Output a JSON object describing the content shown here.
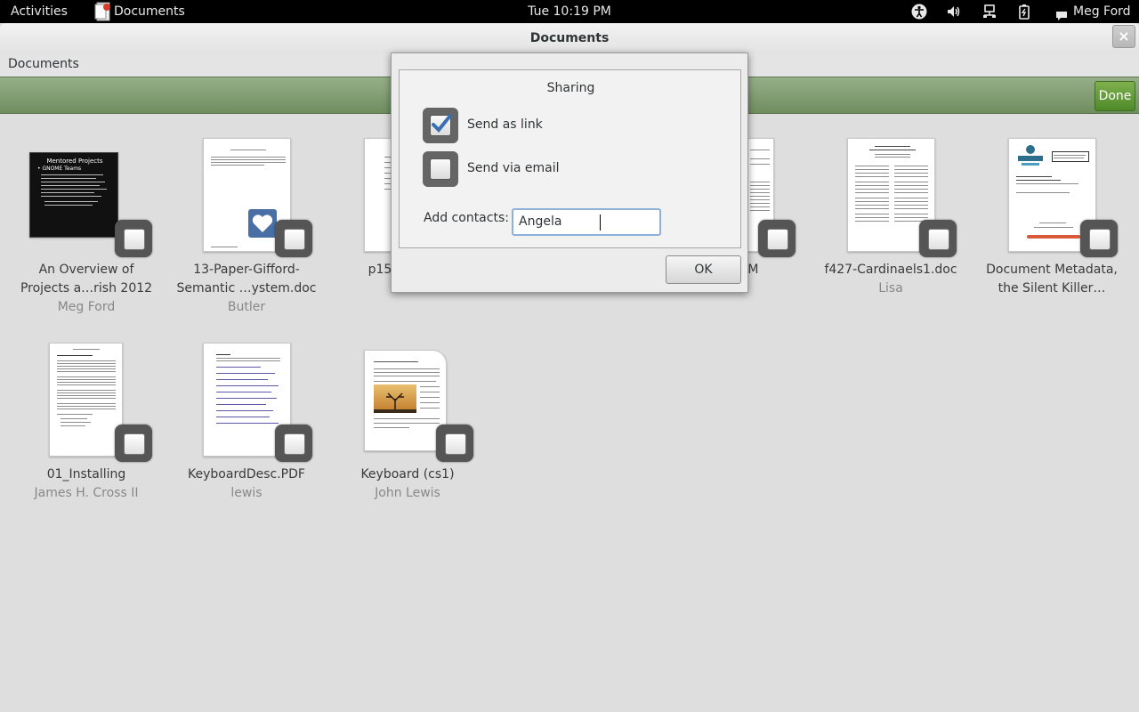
{
  "topbar": {
    "activities": "Activities",
    "app_name": "Documents",
    "clock": "Tue 10:19 PM",
    "user": "Meg Ford"
  },
  "window": {
    "title": "Documents",
    "menu_label": "Documents",
    "done_label": "Done",
    "close_label": "×"
  },
  "documents": [
    {
      "title1": "An Overview of",
      "title2": "Projects a…rish 2012",
      "author": "Meg Ford"
    },
    {
      "title1": "13-Paper-Gifford-",
      "title2": "Semantic …ystem.doc",
      "author": "Butler"
    },
    {
      "title1": "p15",
      "title2": "",
      "author": ""
    },
    {
      "title1": "SM",
      "title2": "",
      "author": ""
    },
    {
      "title1": "f427-Cardinaels1.doc",
      "title2": "",
      "author": "Lisa"
    },
    {
      "title1": "Document Metadata,",
      "title2": "the Silent Killer…",
      "author": ""
    },
    {
      "title1": "01_Installing",
      "title2": "",
      "author": "James H.  Cross II"
    },
    {
      "title1": "KeyboardDesc.PDF",
      "title2": "",
      "author": "lewis"
    },
    {
      "title1": "Keyboard (cs1)",
      "title2": "",
      "author": "John Lewis"
    }
  ],
  "dialog": {
    "title": "Sharing",
    "send_as_link": {
      "label": "Send as link",
      "checked": true
    },
    "send_via_email": {
      "label": "Send via email",
      "checked": false
    },
    "add_contacts_label": "Add contacts:",
    "contacts_value": "Angela",
    "ok_label": "OK"
  },
  "thumb_text": {
    "mentored_title": "Mentored Projects",
    "gnome_teams": "• GNOME Teams"
  },
  "colors": {
    "selection_bar": "#7f9c70",
    "done_button": "#5e9a36",
    "checkmark": "#3a6fb5",
    "entry_focus": "#8fb0d8"
  }
}
